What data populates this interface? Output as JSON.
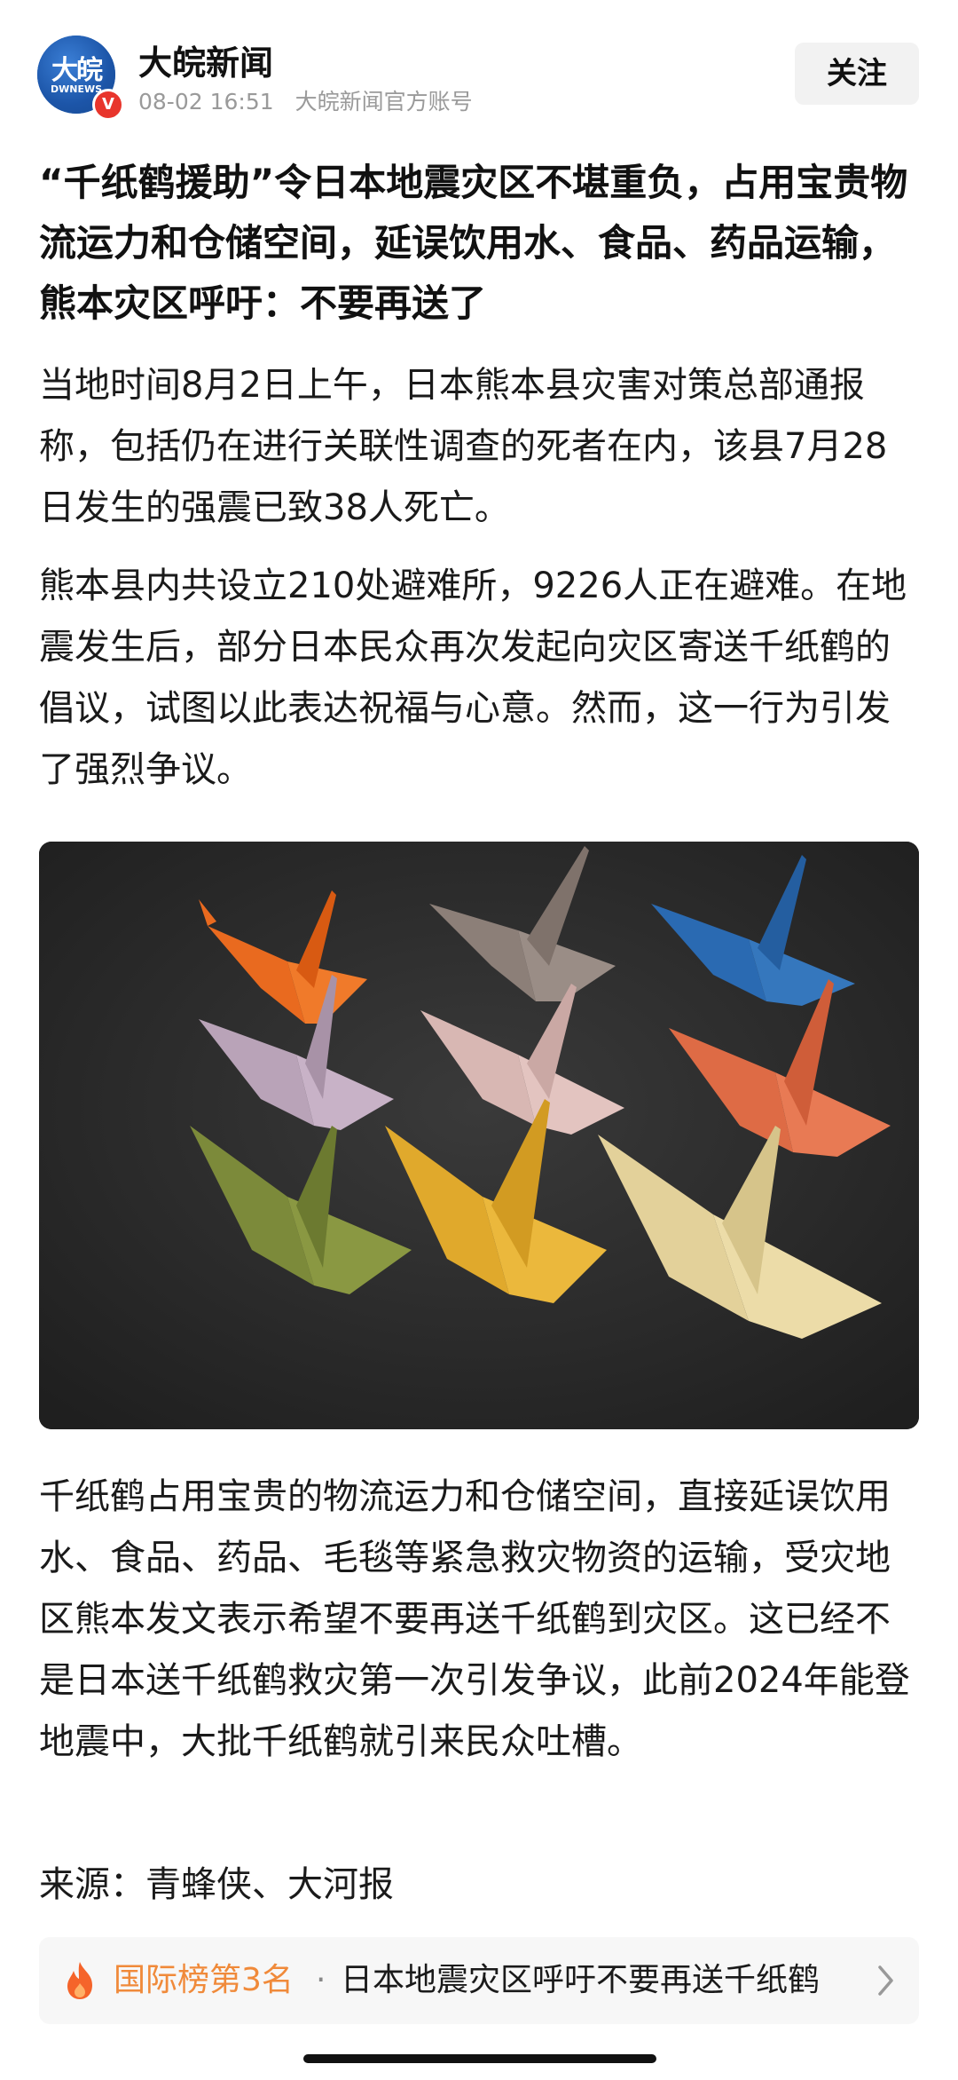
{
  "header": {
    "avatar_text": "大皖",
    "avatar_sub": "DWNEWS",
    "verified_mark": "V",
    "author": "大皖新闻",
    "date": "08-02 16:51",
    "account_type": "大皖新闻官方账号",
    "follow_label": "关注"
  },
  "article": {
    "title": "“千纸鹤援助”令日本地震灾区不堪重负，占用宝贵物流运力和仓储空间，延误饮用水、食品、药品运输，熊本灾区呼吁：不要再送了",
    "paragraph1": "当地时间8月2日上午，日本熊本县灾害对策总部通报称，包括仍在进行关联性调查的死者在内，该县7月28日发生的强震已致38人死亡。",
    "paragraph2": "熊本县内共设立210处避难所，9226人正在避难。在地震发生后，部分日本民众再次发起向灾区寄送千纸鹤的倡议，试图以此表达祝福与心意。然而，这一行为引发了强烈争议。",
    "paragraph3": "千纸鹤占用宝贵的物流运力和仓储空间，直接延误饮用水、食品、药品、毛毯等紧急救灾物资的运输，受灾地区熊本发文表示希望不要再送千纸鹤到灾区。这已经不是日本送千纸鹤救灾第一次引发争议，此前2024年能登地震中，大批千纸鹤就引来民众吐槽。",
    "source": "来源：青蜂侠、大河报"
  },
  "ranking": {
    "label": "国际榜第3名",
    "separator": "·",
    "text": "日本地震灾区呼吁不要再送千纸鹤"
  },
  "colors": {
    "accent_orange": "#f08a3a",
    "verified_red": "#e8352c",
    "avatar_blue": "#1f5fb8"
  }
}
